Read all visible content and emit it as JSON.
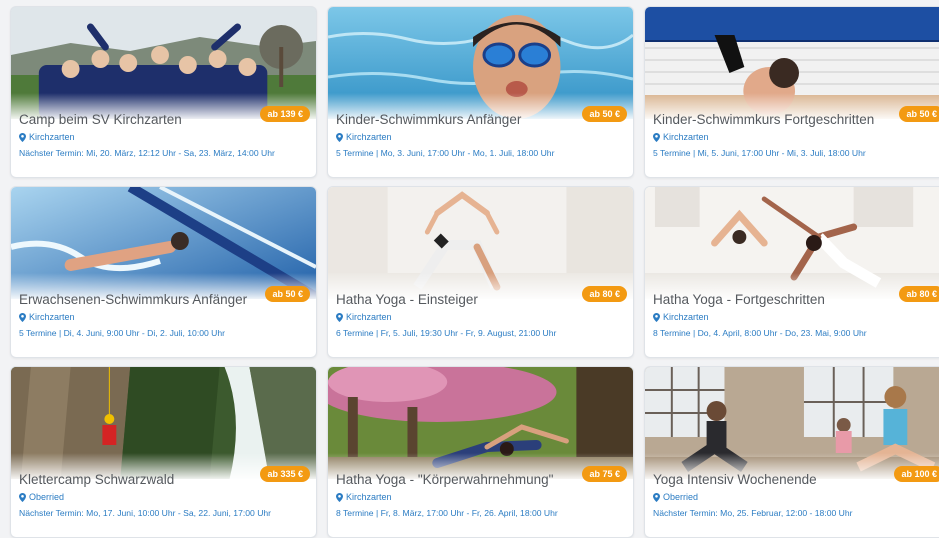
{
  "colors": {
    "accent_orange": "#f39a12",
    "link_blue": "#2b7cc3",
    "title_gray": "#55595e"
  },
  "icons": {
    "location": "map-pin-icon"
  },
  "cards": [
    {
      "title": "Camp beim SV Kirchzarten",
      "location": "Kirchzarten",
      "schedule": "Nächster Termin: Mi, 20. März, 12:12 Uhr - Sa, 23. März, 14:00 Uhr",
      "price": "ab 139 €"
    },
    {
      "title": "Kinder-Schwimmkurs Anfänger",
      "location": "Kirchzarten",
      "schedule": "5 Termine | Mo, 3. Juni, 17:00 Uhr - Mo, 1. Juli, 18:00 Uhr",
      "price": "ab 50 €"
    },
    {
      "title": "Kinder-Schwimmkurs Fortgeschritten",
      "location": "Kirchzarten",
      "schedule": "5 Termine | Mi, 5. Juni, 17:00 Uhr - Mi, 3. Juli, 18:00 Uhr",
      "price": "ab 50 €"
    },
    {
      "title": "Erwachsenen-Schwimmkurs Anfänger",
      "location": "Kirchzarten",
      "schedule": "5 Termine | Di, 4. Juni, 9:00 Uhr - Di, 2. Juli, 10:00 Uhr",
      "price": "ab 50 €"
    },
    {
      "title": "Hatha Yoga - Einsteiger",
      "location": "Kirchzarten",
      "schedule": "6 Termine | Fr, 5. Juli, 19:30 Uhr - Fr, 9. August, 21:00 Uhr",
      "price": "ab 80 €"
    },
    {
      "title": "Hatha Yoga - Fortgeschritten",
      "location": "Kirchzarten",
      "schedule": "8 Termine | Do, 4. April, 8:00 Uhr - Do, 23. Mai, 9:00 Uhr",
      "price": "ab 80 €"
    },
    {
      "title": "Klettercamp Schwarzwald",
      "location": "Oberried",
      "schedule": "Nächster Termin: Mo, 17. Juni, 10:00 Uhr - Sa, 22. Juni, 17:00 Uhr",
      "price": "ab 335 €"
    },
    {
      "title": "Hatha Yoga - \"Körperwahrnehmung\"",
      "location": "Kirchzarten",
      "schedule": "8 Termine | Fr, 8. März, 17:00 Uhr - Fr, 26. April, 18:00 Uhr",
      "price": "ab 75 €"
    },
    {
      "title": "Yoga Intensiv Wochenende",
      "location": "Oberried",
      "schedule": "Nächster Termin: Mo, 25. Februar, 12:00 - 18:00 Uhr",
      "price": "ab 100 €"
    }
  ]
}
